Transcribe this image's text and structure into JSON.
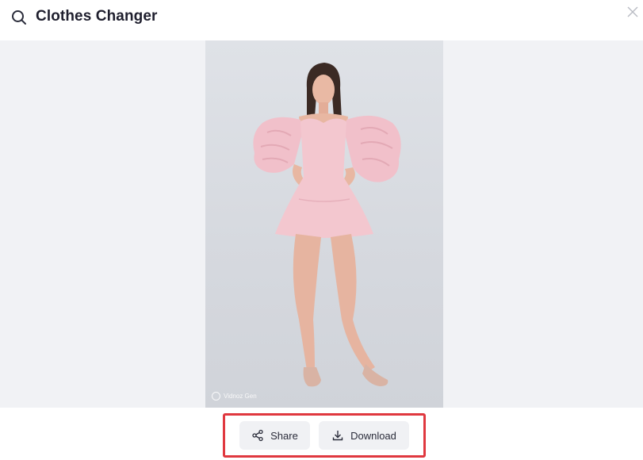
{
  "header": {
    "title": "Clothes Changer",
    "icon": "search-icon"
  },
  "preview": {
    "watermark": "Vidnoz Gen"
  },
  "actions": {
    "share_label": "Share",
    "download_label": "Download"
  },
  "colors": {
    "highlight": "#e0383f",
    "button_bg": "#f0f1f4",
    "preview_bg": "#f1f2f5",
    "dress": "#f3c7cf"
  }
}
